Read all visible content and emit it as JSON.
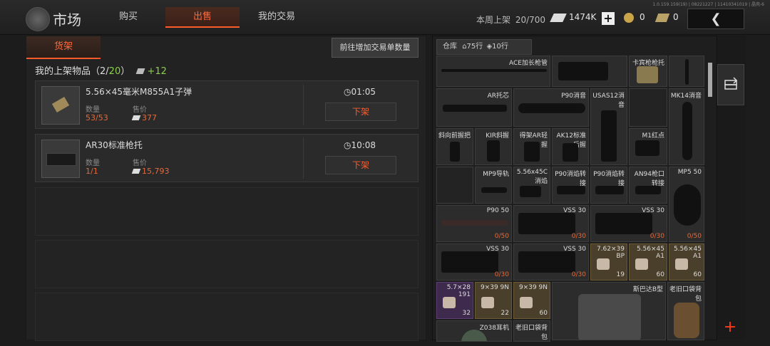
{
  "header": {
    "title": "市场",
    "tabs": [
      {
        "label": "购买"
      },
      {
        "label": "出售"
      },
      {
        "label": "我的交易"
      }
    ],
    "version": "1.0.159.159(19) | 08221227 | 11410341019 | 晶壳-6",
    "weekly_label": "本周上架",
    "weekly_value": "20/700",
    "currency": "1474K",
    "coin_value": "0",
    "ticket_value": "0"
  },
  "shelf": {
    "tab_label": "货架",
    "add_order_label": "前往增加交易单数量",
    "listed_label": "我的上架物品（",
    "listed_count": "2/",
    "listed_max": "20",
    "listed_close": "）",
    "listed_bonus": "+12",
    "items": [
      {
        "name": "5.56×45毫米M855A1子弹",
        "qty_label": "数量",
        "qty": "53/53",
        "price_label": "售价",
        "price": "377",
        "timer": "01:05",
        "delist": "下架"
      },
      {
        "name": "AR30标准枪托",
        "qty_label": "数量",
        "qty": "1/1",
        "price_label": "售价",
        "price": "15,793",
        "timer": "10:08",
        "delist": "下架"
      }
    ]
  },
  "warehouse": {
    "label": "仓库",
    "rows_a": "75行",
    "rows_b": "10行",
    "cells": [
      {
        "label": "ACE加长枪管",
        "count": ""
      },
      {
        "label": "",
        "count": ""
      },
      {
        "label": "卡宾枪枪托",
        "count": ""
      },
      {
        "label": "AR托芯",
        "count": ""
      },
      {
        "label": "P90消音",
        "count": ""
      },
      {
        "label": "USAS12消音",
        "count": ""
      },
      {
        "label": "MK14消音",
        "count": ""
      },
      {
        "label": "斜向前握把",
        "count": ""
      },
      {
        "label": "KIR斜握",
        "count": ""
      },
      {
        "label": "得架AR轻握",
        "count": ""
      },
      {
        "label": "AK12标准后握",
        "count": ""
      },
      {
        "label": "M1红点",
        "count": ""
      },
      {
        "label": "MP9导轨",
        "count": ""
      },
      {
        "label": "5.56x45C消焰",
        "count": ""
      },
      {
        "label": "P90消焰转接",
        "count": ""
      },
      {
        "label": "P90消焰转接",
        "count": ""
      },
      {
        "label": "AN94枪口转接",
        "count": ""
      },
      {
        "label": "MP5 50",
        "count": "0/50"
      },
      {
        "label": "P90 50",
        "count": "0/50"
      },
      {
        "label": "VSS 30",
        "count": "0/30"
      },
      {
        "label": "VSS 30",
        "count": "0/30"
      },
      {
        "label": "VSS 30",
        "count": "0/30"
      },
      {
        "label": "VSS 30",
        "count": "0/30"
      },
      {
        "label": "7.62×39 BP",
        "count": "19"
      },
      {
        "label": "5.56×45 A1",
        "count": "60"
      },
      {
        "label": "5.56×45 A1",
        "count": "60"
      },
      {
        "label": "5.7×28 191",
        "count": "32"
      },
      {
        "label": "9×39 9N",
        "count": "22"
      },
      {
        "label": "9×39 9N",
        "count": "60"
      },
      {
        "label": "斯巴达B型",
        "count": ""
      },
      {
        "label": "老旧口袋背包",
        "count": ""
      },
      {
        "label": "Z038耳机",
        "count": ""
      },
      {
        "label": "老旧口袋背包",
        "count": ""
      }
    ]
  },
  "colors": {
    "accent": "#ff5a2a",
    "price": "#e56a3a",
    "bonus": "#8bd04a"
  }
}
